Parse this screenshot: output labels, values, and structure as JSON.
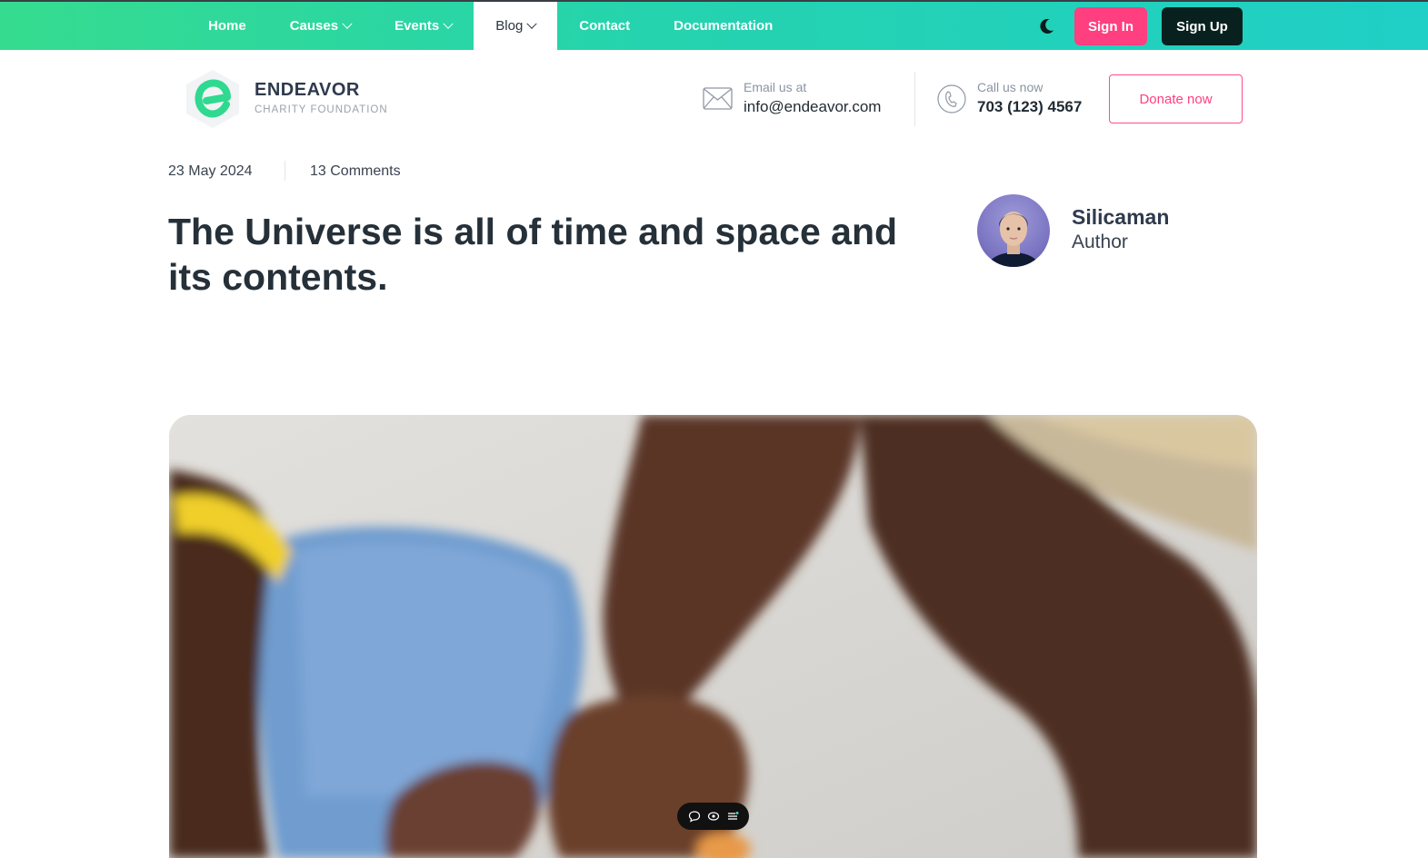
{
  "nav": {
    "items": [
      {
        "label": "Home",
        "dropdown": false,
        "active": false
      },
      {
        "label": "Causes",
        "dropdown": true,
        "active": false
      },
      {
        "label": "Events",
        "dropdown": true,
        "active": false
      },
      {
        "label": "Blog",
        "dropdown": true,
        "active": true
      },
      {
        "label": "Contact",
        "dropdown": false,
        "active": false
      },
      {
        "label": "Documentation",
        "dropdown": false,
        "active": false
      }
    ],
    "signin_label": "Sign In",
    "signup_label": "Sign Up"
  },
  "header": {
    "brand_name": "ENDEAVOR",
    "brand_sub": "CHARITY FOUNDATION",
    "email_label": "Email us at",
    "email_value": "info@endeavor.com",
    "call_label": "Call us now",
    "call_value": "703 (123) 4567",
    "donate_label": "Donate now"
  },
  "post": {
    "date": "23 May 2024",
    "comments": "13 Comments",
    "title": "The Universe is all of time and space and its contents.",
    "author_name": "Silicaman",
    "author_role": "Author"
  },
  "colors": {
    "nav_gradient_start": "#35dc8f",
    "nav_gradient_end": "#20cfc6",
    "accent_pink": "#ff3f7f",
    "dark_button": "#08211f",
    "logo_green": "#2fd98f"
  },
  "icons": [
    "moon-icon",
    "mail-icon",
    "phone-icon",
    "comment-icon",
    "eye-icon",
    "list-icon"
  ]
}
